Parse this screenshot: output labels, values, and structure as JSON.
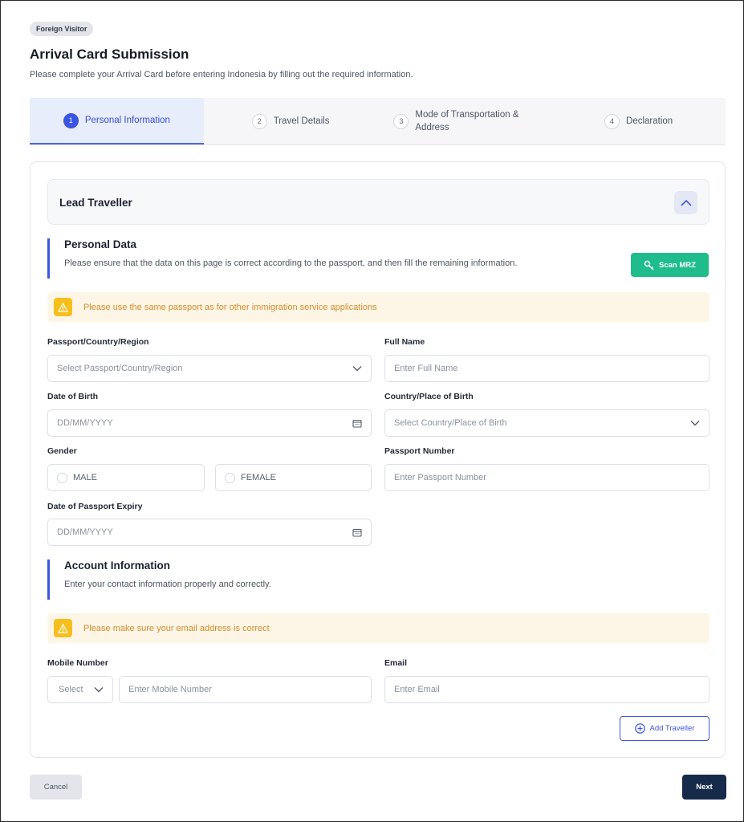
{
  "badge": "Foreign Visitor",
  "title": "Arrival Card Submission",
  "subtitle": "Please complete your Arrival Card before entering Indonesia by filling out the required information.",
  "steps": [
    {
      "num": "1",
      "label": "Personal Information",
      "active": true
    },
    {
      "num": "2",
      "label": "Travel Details",
      "active": false
    },
    {
      "num": "3",
      "label": "Mode of Transportation & Address",
      "active": false
    },
    {
      "num": "4",
      "label": "Declaration",
      "active": false
    }
  ],
  "lead": {
    "title": "Lead Traveller",
    "toggle_icon": "chevron-up-icon"
  },
  "personal": {
    "title": "Personal Data",
    "desc": "Please ensure that the data on this page is correct according to the passport, and then fill the remaining information.",
    "scan_label": "Scan MRZ",
    "alert": "Please use the same passport as for other immigration service applications"
  },
  "fields": {
    "passport_country": {
      "label": "Passport/Country/Region",
      "placeholder": "Select Passport/Country/Region"
    },
    "full_name": {
      "label": "Full Name",
      "placeholder": "Enter Full Name"
    },
    "dob": {
      "label": "Date of Birth",
      "placeholder": "DD/MM/YYYY"
    },
    "birth_place": {
      "label": "Country/Place of Birth",
      "placeholder": "Select Country/Place of Birth"
    },
    "gender": {
      "label": "Gender",
      "options": [
        "MALE",
        "FEMALE"
      ]
    },
    "passport_number": {
      "label": "Passport Number",
      "placeholder": "Enter Passport Number"
    },
    "passport_expiry": {
      "label": "Date of Passport Expiry",
      "placeholder": "DD/MM/YYYY"
    }
  },
  "account": {
    "title": "Account Information",
    "desc": "Enter your contact information properly and correctly.",
    "alert": "Please make sure your email address is correct",
    "mobile": {
      "label": "Mobile Number",
      "code_placeholder": "Select",
      "placeholder": "Enter Mobile Number"
    },
    "email": {
      "label": "Email",
      "placeholder": "Enter Email"
    }
  },
  "buttons": {
    "add_traveller": "Add Traveller",
    "cancel": "Cancel",
    "next": "Next"
  },
  "colors": {
    "accent": "#3a55e0",
    "scan": "#1fbc8c",
    "warning": "#f7bf1e",
    "primary_dark": "#162a4a"
  }
}
